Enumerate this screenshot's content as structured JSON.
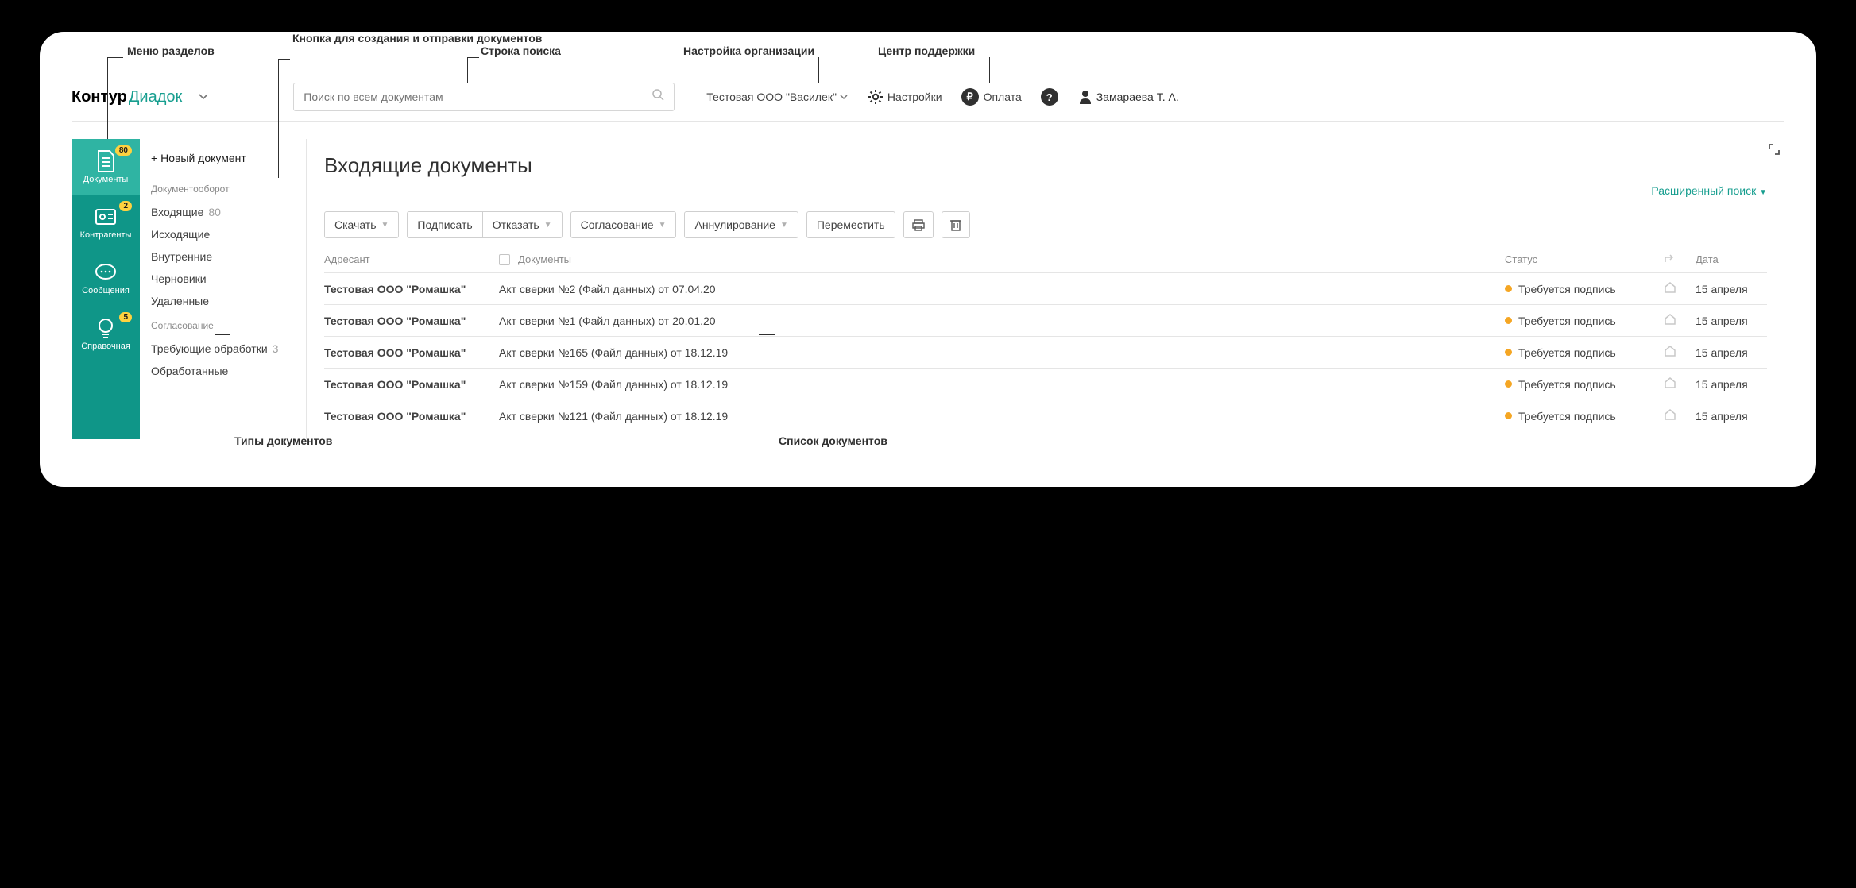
{
  "annotations": {
    "menu": "Меню разделов",
    "create": "Кнопка для создания и отправки документов",
    "search": "Строка поиска",
    "org": "Настройка организации",
    "help": "Центр поддержки",
    "types": "Типы документов",
    "list": "Список документов"
  },
  "header": {
    "logo_a": "Контур",
    "logo_b": "Диадок",
    "search_placeholder": "Поиск по всем документам",
    "org": "Тестовая ООО \"Василек\"",
    "settings": "Настройки",
    "pay": "Оплата",
    "user": "Замараева Т. А."
  },
  "nav": [
    {
      "label": "Документы",
      "badge": "80"
    },
    {
      "label": "Контрагенты",
      "badge": "2"
    },
    {
      "label": "Сообщения",
      "badge": ""
    },
    {
      "label": "Справочная",
      "badge": "5"
    }
  ],
  "sidebar": {
    "new_doc": "Новый документ",
    "group1_hdr": "Документооборот",
    "group1": [
      {
        "label": "Входящие",
        "count": "80"
      },
      {
        "label": "Исходящие",
        "count": ""
      },
      {
        "label": "Внутренние",
        "count": ""
      },
      {
        "label": "Черновики",
        "count": ""
      },
      {
        "label": "Удаленные",
        "count": ""
      }
    ],
    "group2_hdr": "Согласование",
    "group2": [
      {
        "label": "Требующие обработки",
        "count": "3"
      },
      {
        "label": "Обработанные",
        "count": ""
      }
    ]
  },
  "main": {
    "title": "Входящие документы",
    "adv_search": "Расширенный поиск",
    "toolbar": {
      "download": "Скачать",
      "sign": "Подписать",
      "reject": "Отказать",
      "approve": "Согласование",
      "void": "Аннулирование",
      "move": "Переместить"
    },
    "columns": {
      "sender": "Адресант",
      "docs": "Документы",
      "status": "Статус",
      "date": "Дата"
    },
    "rows": [
      {
        "sender": "Тестовая ООО \"Ромашка\"",
        "doc": "Акт сверки №2 (Файл данных) от 07.04.20",
        "status": "Требуется подпись",
        "date": "15 апреля"
      },
      {
        "sender": "Тестовая ООО \"Ромашка\"",
        "doc": "Акт сверки №1 (Файл данных) от 20.01.20",
        "status": "Требуется подпись",
        "date": "15 апреля"
      },
      {
        "sender": "Тестовая ООО \"Ромашка\"",
        "doc": "Акт сверки №165 (Файл данных) от 18.12.19",
        "status": "Требуется подпись",
        "date": "15 апреля"
      },
      {
        "sender": "Тестовая ООО \"Ромашка\"",
        "doc": "Акт сверки №159 (Файл данных) от 18.12.19",
        "status": "Требуется подпись",
        "date": "15 апреля"
      },
      {
        "sender": "Тестовая ООО \"Ромашка\"",
        "doc": "Акт сверки №121 (Файл данных) от 18.12.19",
        "status": "Требуется подпись",
        "date": "15 апреля"
      }
    ]
  }
}
